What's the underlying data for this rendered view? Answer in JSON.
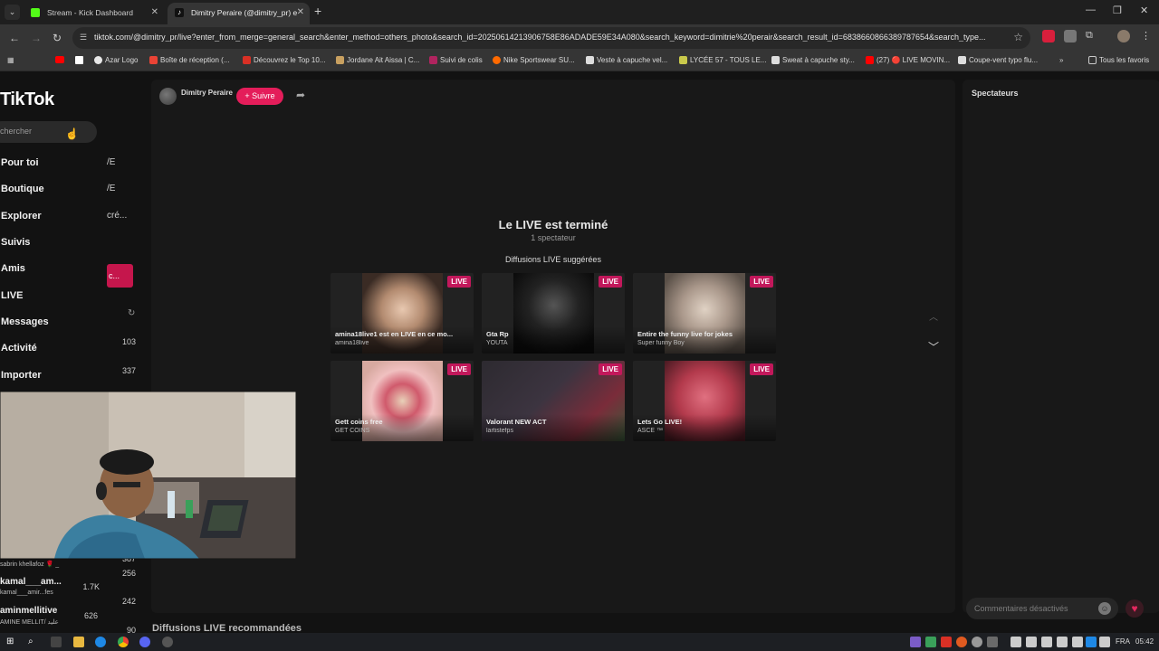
{
  "browser": {
    "tabs": [
      {
        "title": "Stream - Kick Dashboard",
        "favicon_color": "#53fc18"
      },
      {
        "title": "Dimitry Peraire (@dimitry_pr) e",
        "favicon_color": "#ffffff"
      }
    ],
    "url": "tiktok.com/@dimitry_pr/live?enter_from_merge=general_search&enter_method=others_photo&search_id=20250614213906758E86ADADE59E34A080&search_keyword=dimitrie%20perair&search_result_id=6838660866389787654&search_type...",
    "bookmarks": [
      {
        "label": "Azar Logo",
        "color": "#e8e8e8"
      },
      {
        "label": "Boîte de réception (...",
        "color": "#ea4335"
      },
      {
        "label": "Découvrez le Top 10...",
        "color": "#d93025"
      },
      {
        "label": "Jordane Ait Aissa | C...",
        "color": "#c8a060"
      },
      {
        "label": "Suivi de colis",
        "color": "#b0245f"
      },
      {
        "label": "Nike Sportswear SU...",
        "color": "#ff6a00"
      },
      {
        "label": "Veste à capuche vel...",
        "color": "#dddddd"
      },
      {
        "label": "LYCÉE 57 - TOUS LE...",
        "color": "#c9c94b"
      },
      {
        "label": "Sweat à capuche sty...",
        "color": "#dddddd"
      },
      {
        "label": "(27) 🔴 LIVE MOVIN...",
        "color": "#ff0000"
      },
      {
        "label": "Coupe-vent typo flu...",
        "color": "#dddddd"
      }
    ],
    "all_bookmarks": "Tous les favoris"
  },
  "sidebar": {
    "logo": "TikTok",
    "search_placeholder": "chercher",
    "items": [
      "Pour toi",
      "Boutique",
      "Explorer",
      "Suivis",
      "Amis",
      "LIVE",
      "Messages",
      "Activité",
      "Importer"
    ],
    "peek": {
      "a": "/E",
      "b": "/E",
      "c": "cré...",
      "btn": "c..."
    },
    "counts": [
      "103",
      "337",
      "387",
      "256",
      "242",
      "90"
    ],
    "viewers": [
      {
        "name": "",
        "sub": "sabrin khellafoz 🌹 _"
      },
      {
        "name": "kamal___am...",
        "sub": "kamal___amir...fes",
        "count": "1.7K"
      },
      {
        "name": "aminmellitive",
        "sub": "AMINE MELLIT/ عليد",
        "count": "626"
      }
    ]
  },
  "main": {
    "host_name": "Dimitry Peraire",
    "follow_label": "+ Suivre",
    "ended_title": "Le LIVE est terminé",
    "ended_sub": "1 spectateur",
    "suggested_title": "Diffusions LIVE suggérées",
    "cards": [
      {
        "title": "amina18live1 est en LIVE en ce mo...",
        "sub": "amina18live",
        "badge": "LIVE",
        "thumb": "#c4a28a",
        "bg": "#3a2b24"
      },
      {
        "title": "Gta Rp",
        "sub": "YOUTA",
        "badge": "LIVE",
        "thumb": "#1b1b1b",
        "bg": "#141414"
      },
      {
        "title": "Entire the funny live for jokes",
        "sub": "Super funny Boy",
        "badge": "LIVE",
        "thumb": "#b9a796",
        "bg": "#5a5048"
      },
      {
        "title": "Gett coins free",
        "sub": "GET COINS",
        "badge": "LIVE",
        "thumb": "#d7a9a0",
        "bg": "#4a3030"
      },
      {
        "title": "Valorant NEW ACT",
        "sub": "lartistefps",
        "badge": "LIVE",
        "thumb": "#2d2a30",
        "bg": "#211c22"
      },
      {
        "title": "Lets Go LIVE!",
        "sub": "ASCE ™",
        "badge": "LIVE",
        "thumb": "#b33a4c",
        "bg": "#4a1a22"
      }
    ],
    "recommended_title": "Diffusions LIVE recommandées"
  },
  "spectators": {
    "title": "Spectateurs",
    "comments_disabled": "Commentaires désactivés"
  },
  "taskbar": {
    "lang": "FRA",
    "time": "05:42"
  }
}
